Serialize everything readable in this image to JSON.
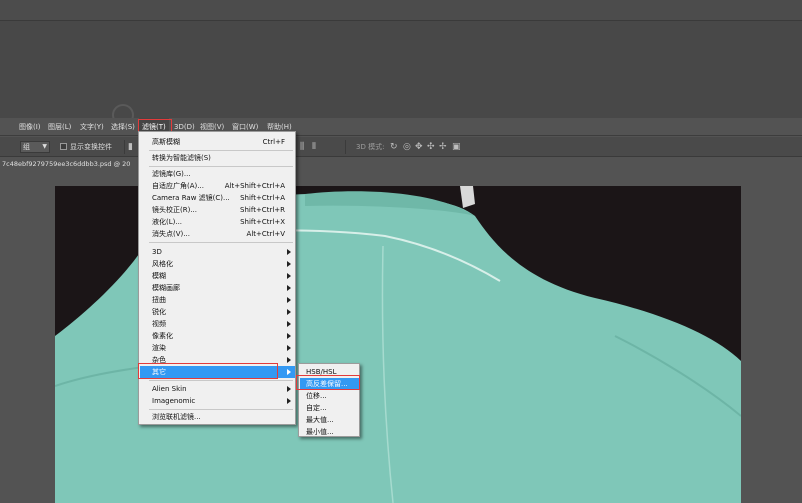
{
  "menubar": {
    "items": [
      {
        "label": "图像(I)"
      },
      {
        "label": "图层(L)"
      },
      {
        "label": "文字(Y)"
      },
      {
        "label": "选择(S)"
      },
      {
        "label": "滤镜(T)"
      },
      {
        "label": "3D(D)"
      },
      {
        "label": "视图(V)"
      },
      {
        "label": "窗口(W)"
      },
      {
        "label": "帮助(H)"
      }
    ]
  },
  "options": {
    "select_value": "组",
    "checkbox_label": "显示变换控件",
    "mode_label": "3D 模式:"
  },
  "document": {
    "tab_title": "7c48ebf9279759ee3c6ddbb3.psd @ 20"
  },
  "filter_menu": {
    "items": [
      {
        "label": "高斯模糊",
        "shortcut": "Ctrl+F"
      },
      {
        "label": "转换为智能滤镜(S)",
        "shortcut": ""
      },
      {
        "label": "滤镜库(G)...",
        "shortcut": ""
      },
      {
        "label": "自适应广角(A)...",
        "shortcut": "Alt+Shift+Ctrl+A"
      },
      {
        "label": "Camera Raw 滤镜(C)...",
        "shortcut": "Shift+Ctrl+A"
      },
      {
        "label": "镜头校正(R)...",
        "shortcut": "Shift+Ctrl+R"
      },
      {
        "label": "液化(L)...",
        "shortcut": "Shift+Ctrl+X"
      },
      {
        "label": "消失点(V)...",
        "shortcut": "Alt+Ctrl+V"
      },
      {
        "label": "3D"
      },
      {
        "label": "风格化"
      },
      {
        "label": "模糊"
      },
      {
        "label": "模糊画廊"
      },
      {
        "label": "扭曲"
      },
      {
        "label": "锐化"
      },
      {
        "label": "视频"
      },
      {
        "label": "像素化"
      },
      {
        "label": "渲染"
      },
      {
        "label": "杂色"
      },
      {
        "label": "其它"
      },
      {
        "label": "Alien Skin"
      },
      {
        "label": "Imagenomic"
      },
      {
        "label": "浏览联机滤镜..."
      }
    ]
  },
  "other_submenu": {
    "items": [
      {
        "label": "HSB/HSL"
      },
      {
        "label": "高反差保留..."
      },
      {
        "label": "位移..."
      },
      {
        "label": "自定..."
      },
      {
        "label": "最大值..."
      },
      {
        "label": "最小值..."
      }
    ]
  },
  "colors": {
    "highlight": "#3399f3",
    "annotation_red": "#e23b3b",
    "garment": "#7fc7b8"
  }
}
